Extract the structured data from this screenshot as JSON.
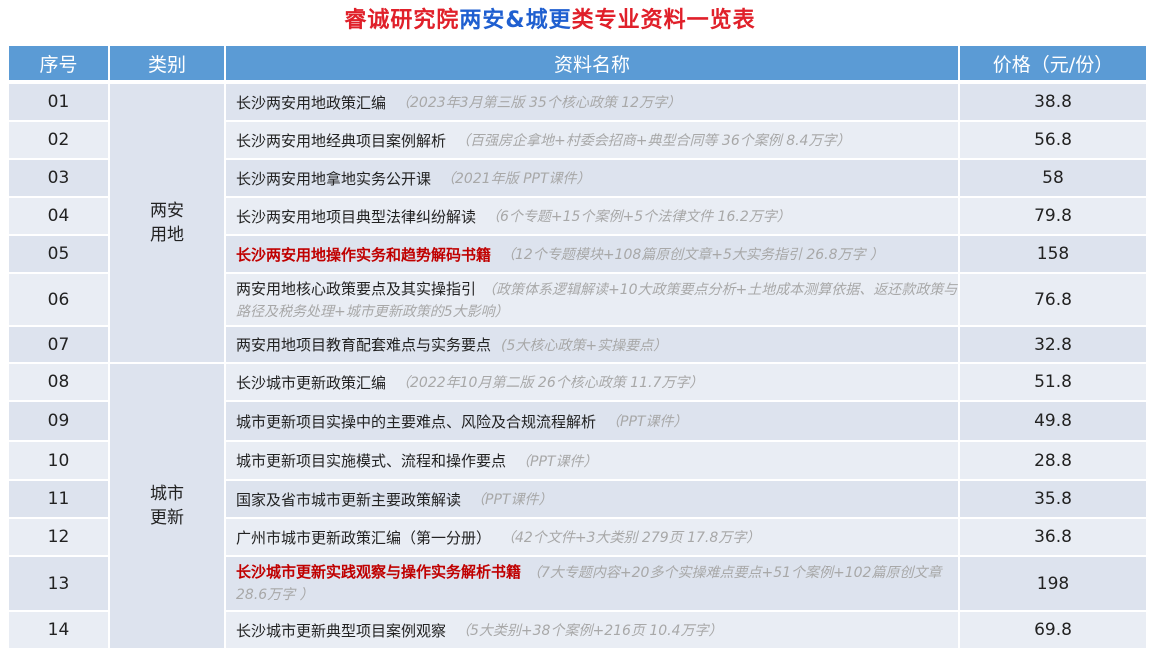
{
  "title": {
    "part1": "睿诚研究院",
    "part2": "两安&城更",
    "part3": "类专业资料一览表"
  },
  "headers": {
    "seq": "序号",
    "category": "类别",
    "name": "资料名称",
    "price": "价格（元/份）"
  },
  "categories": [
    {
      "line1": "两安",
      "line2": "用地"
    },
    {
      "line1": "城市",
      "line2": "更新"
    }
  ],
  "rows": [
    {
      "seq": "01",
      "name": "长沙两安用地政策汇编",
      "note": "（2023年3月第三版  35个核心政策  12万字）",
      "price": "38.8",
      "highlight": false
    },
    {
      "seq": "02",
      "name": "长沙两安用地经典项目案例解析",
      "note": "（百强房企拿地+村委会招商+典型合同等  36个案例  8.4万字）",
      "price": "56.8",
      "highlight": false
    },
    {
      "seq": "03",
      "name": "长沙两安用地拿地实务公开课",
      "note": "（2021年版 PPT课件）",
      "price": "58",
      "highlight": false
    },
    {
      "seq": "04",
      "name": "长沙两安用地项目典型法律纠纷解读",
      "note": "（6个专题+15个案例+5个法律文件  16.2万字）",
      "price": "79.8",
      "highlight": false
    },
    {
      "seq": "05",
      "name": "长沙两安用地操作实务和趋势解码书籍",
      "note": "（12个专题模块+108篇原创文章+5大实务指引  26.8万字 ）",
      "price": "158",
      "highlight": true
    },
    {
      "seq": "06",
      "name": "两安用地核心政策要点及其实操指引",
      "note": "（政策体系逻辑解读+10大政策要点分析+土地成本测算依据、返还款政策与路径及税务处理+城市更新政策的5大影响）",
      "price": "76.8",
      "highlight": false
    },
    {
      "seq": "07",
      "name": "两安用地项目教育配套难点与实务要点",
      "note": "(5大核心政策+实操要点）",
      "price": "32.8",
      "highlight": false
    },
    {
      "seq": "08",
      "name": "长沙城市更新政策汇编",
      "note": "（2022年10月第二版  26个核心政策  11.7万字）",
      "price": "51.8",
      "highlight": false
    },
    {
      "seq": "09",
      "name": "城市更新项目实操中的主要难点、风险及合规流程解析",
      "note": "（PPT课件）",
      "price": "49.8",
      "highlight": false
    },
    {
      "seq": "10",
      "name": "城市更新项目实施模式、流程和操作要点",
      "note": "（PPT课件）",
      "price": "28.8",
      "highlight": false
    },
    {
      "seq": "11",
      "name": "国家及省市城市更新主要政策解读",
      "note": "（PPT课件）",
      "price": "35.8",
      "highlight": false
    },
    {
      "seq": "12",
      "name": "广州市城市更新政策汇编（第一分册）",
      "note": "（42个文件+3大类别 279页 17.8万字）",
      "price": "36.8",
      "highlight": false
    },
    {
      "seq": "13",
      "name": "长沙城市更新实践观察与操作实务解析书籍",
      "note": "（7大专题内容+20多个实操难点要点+51个案例+102篇原创文章  28.6万字 ）",
      "price": "198",
      "highlight": true
    },
    {
      "seq": "14",
      "name": "长沙城市更新典型项目案例观察",
      "note": "（5大类别+38个案例+216页 10.4万字）",
      "price": "69.8",
      "highlight": false
    }
  ]
}
